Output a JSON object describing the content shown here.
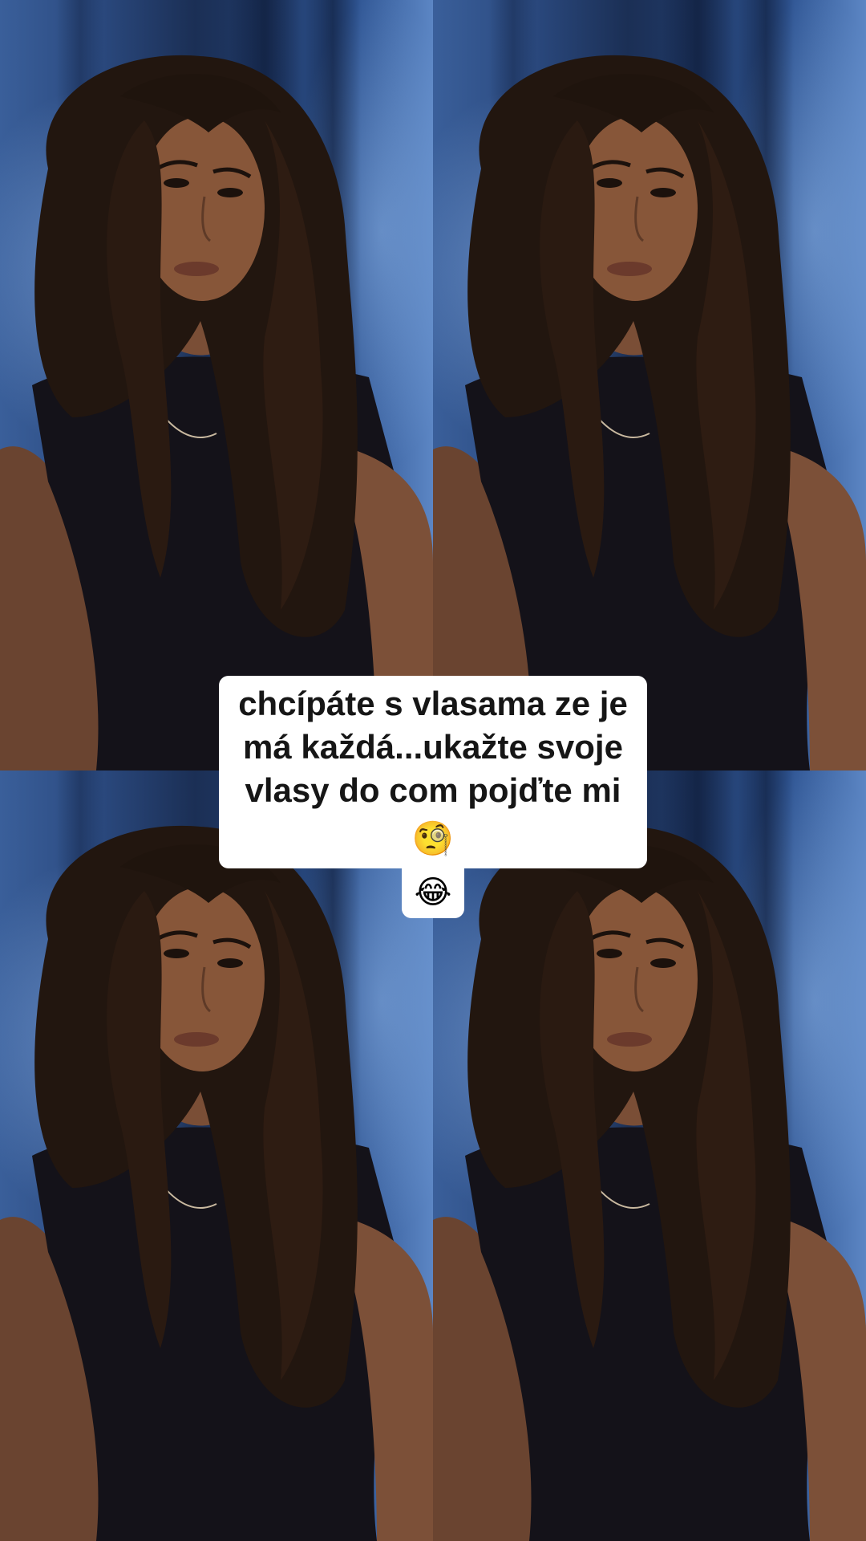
{
  "video": {
    "layout": "2x2 mirrored grid of the same selfie video frame",
    "tiles": [
      "top-left",
      "top-right",
      "bottom-left",
      "bottom-right"
    ]
  },
  "caption": {
    "line1": "chcípáte s vlasama ze je",
    "line2": "má každá...ukažte svoje",
    "line3": "vlasy do com pojďte mi",
    "emoji_monocle": "🧐",
    "emoji_laugh": "😂"
  },
  "colors": {
    "caption_bg": "#ffffff",
    "caption_text": "#161616",
    "background_blue": "#2b4a80"
  }
}
